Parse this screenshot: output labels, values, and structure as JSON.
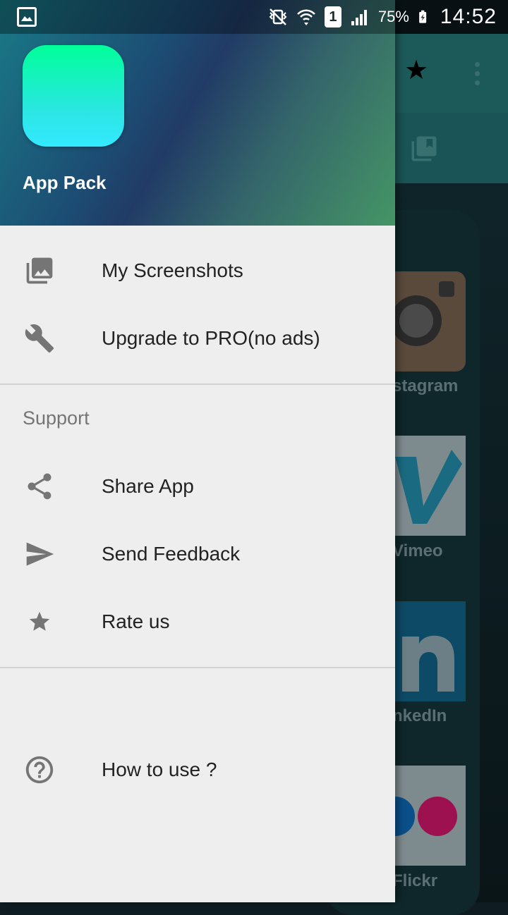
{
  "status_bar": {
    "battery_percent": "75%",
    "time": "14:52",
    "sim_label": "1",
    "icons": [
      "image-icon",
      "mute-vibrate-icon",
      "wifi-icon",
      "sim-icon",
      "signal-icon",
      "battery-icon"
    ]
  },
  "drawer": {
    "header": {
      "app_name": "App Pack",
      "gradient_colors": [
        "#1a7a86",
        "#213b66",
        "#459566"
      ],
      "app_icon_colors": [
        "#00ff99",
        "#33e9ff"
      ]
    },
    "primary_items": [
      {
        "label": "My Screenshots",
        "icon": "photo-library-icon"
      },
      {
        "label": "Upgrade to PRO(no ads)",
        "icon": "wrench-icon"
      }
    ],
    "support_section": {
      "title": "Support",
      "items": [
        {
          "label": "Share App",
          "icon": "share-icon"
        },
        {
          "label": "Send Feedback",
          "icon": "send-icon"
        },
        {
          "label": "Rate us",
          "icon": "star-icon"
        }
      ]
    },
    "footer_item": {
      "label": "How to use ?",
      "icon": "help-circle-icon"
    }
  },
  "background_app": {
    "tiles": [
      {
        "label": "stagram"
      },
      {
        "label": "Vimeo"
      },
      {
        "label": "nkedIn"
      },
      {
        "label": "Flickr"
      }
    ]
  }
}
